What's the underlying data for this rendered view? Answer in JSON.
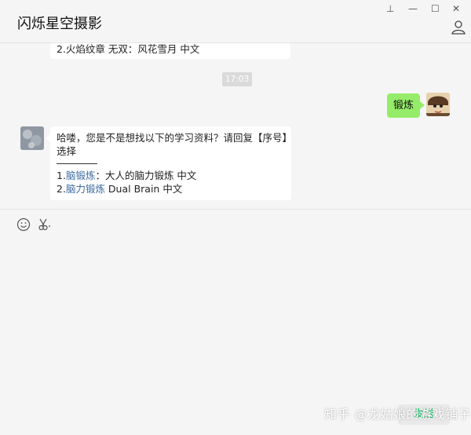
{
  "window": {
    "title": "闪烁星空摄影",
    "controls": {
      "pin": "⊥",
      "minimize": "—",
      "maximize": "☐",
      "close": "✕"
    }
  },
  "chat": {
    "messages": [
      {
        "side": "left",
        "lines": [
          "2.火焰纹章 无双：风花雪月 中文"
        ]
      },
      {
        "type": "timestamp",
        "text": "17:03"
      },
      {
        "side": "right",
        "text": "锻炼"
      },
      {
        "side": "left",
        "line1": "哈喽，您是不是想找以下的学习资料？请回复【序号】",
        "line2": "选择",
        "item1_prefix": "1.",
        "item1_link": "脑锻炼",
        "item1_rest": "：大人的脑力锻炼 中文",
        "item2_prefix": "2.",
        "item2_link": "脑力锻炼",
        "item2_rest": " Dual Brain 中文"
      }
    ]
  },
  "input": {
    "send_label": "发送"
  },
  "watermark": "知乎 @龙姑娘的游戏铺子",
  "colors": {
    "accent_green": "#95ec69",
    "send_text": "#07c160",
    "link": "#3b6aa0"
  }
}
